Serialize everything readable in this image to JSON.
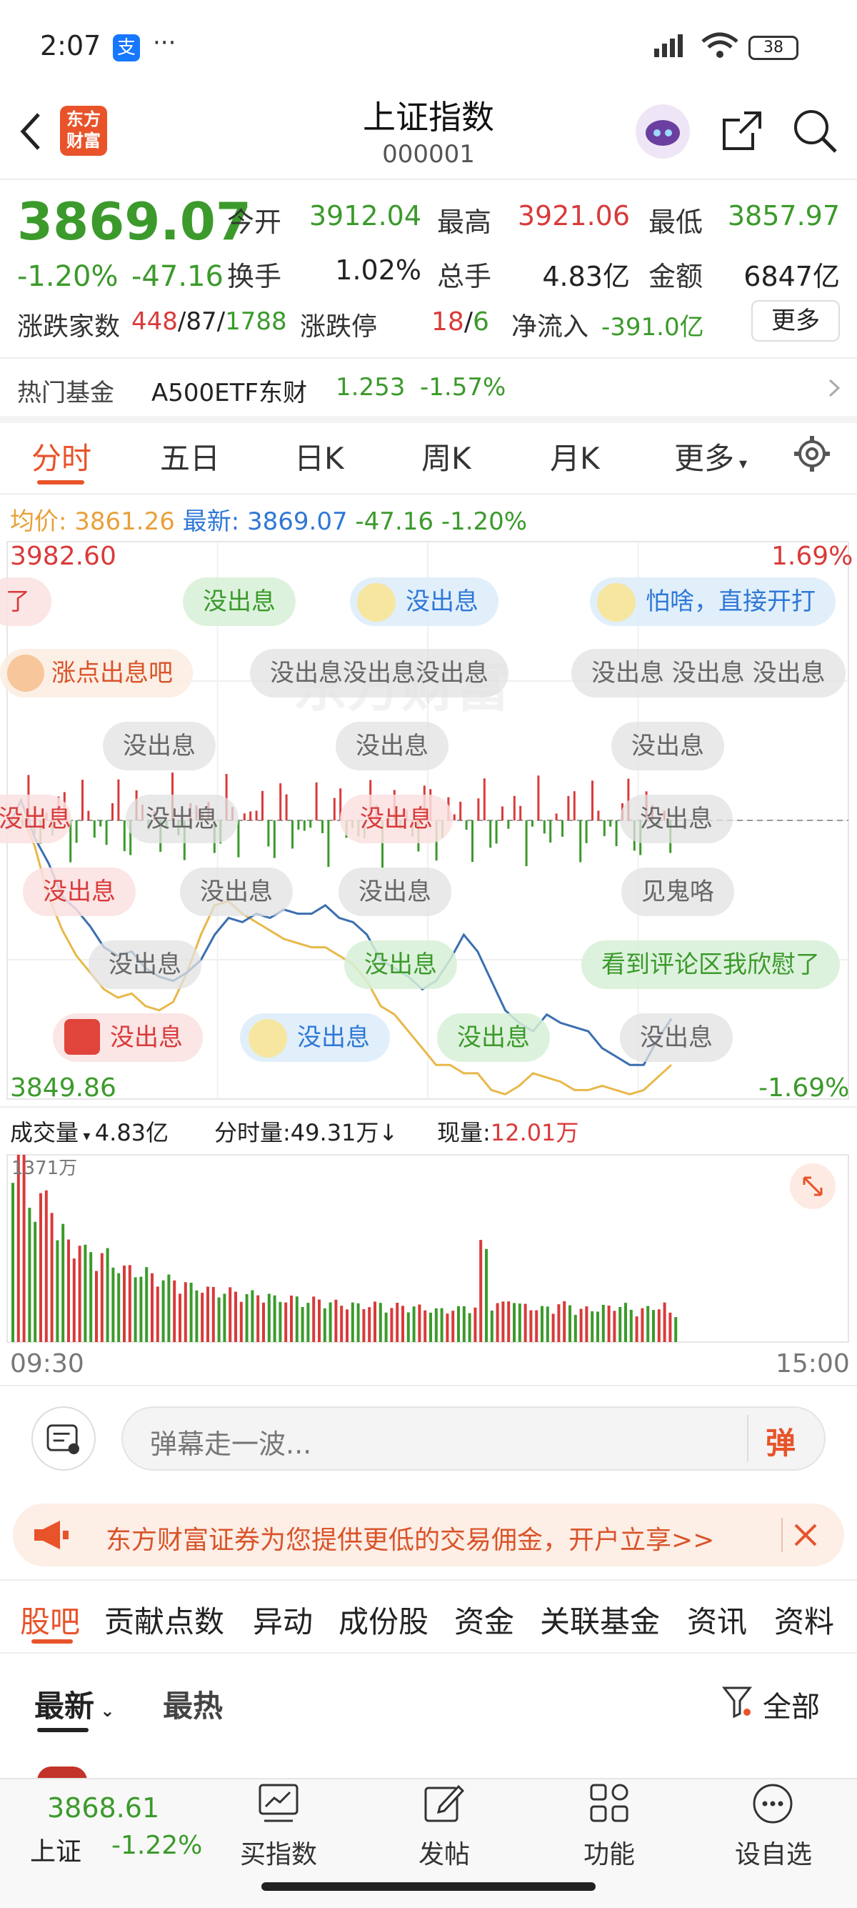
{
  "status": {
    "time": "2:07",
    "alipay": "支",
    "dots": "···",
    "battery": "38"
  },
  "header": {
    "title": "上证指数",
    "code": "000001",
    "logo_line1": "东方",
    "logo_line2": "财富"
  },
  "quote": {
    "price": "3869.07",
    "pct": "-1.20%",
    "chg": "-47.16",
    "open_lbl": "今开",
    "open": "3912.04",
    "high_lbl": "最高",
    "high": "3921.06",
    "low_lbl": "最低",
    "low": "3857.97",
    "turnover_lbl": "换手",
    "turnover": "1.02%",
    "vol_lbl": "总手",
    "vol": "4.83亿",
    "amt_lbl": "金额",
    "amt": "6847亿",
    "adv_lbl": "涨跌家数",
    "adv": "448",
    "flat": "87",
    "dec": "1788",
    "limit_lbl": "涨跌停",
    "limit_up": "18",
    "limit_down": "6",
    "inflow_lbl": "净流入",
    "inflow": "-391.0亿",
    "more": "更多"
  },
  "fund": {
    "label": "热门基金",
    "name": "A500ETF东财",
    "price": "1.253",
    "pct": "-1.57%"
  },
  "tabs": [
    "分时",
    "五日",
    "日K",
    "周K",
    "月K",
    "更多"
  ],
  "avgline": {
    "avg_lbl": "均价:",
    "avg": "3861.26",
    "new_lbl": "最新:",
    "new": "3869.07",
    "chg": "-47.16",
    "pct": "-1.20%"
  },
  "chart_labels": {
    "top_price": "3982.60",
    "top_pct": "1.69%",
    "bottom_price": "3849.86",
    "bottom_pct": "-1.69%",
    "watermark": "东方财富"
  },
  "danmaku": [
    "了",
    "没出息",
    "没出息",
    "怕啥，直接开打",
    "涨点出息吧",
    "没出息没出息没出息",
    "没出息 没出息 没出息",
    "没出息",
    "没出息",
    "没出息",
    "没出息",
    "没出息",
    "没出息",
    "没出息",
    "没出息",
    "没出息",
    "没出息",
    "见鬼咯",
    "没出息",
    "没出息",
    "看到评论区我欣慰了",
    "没出息",
    "没出息",
    "没出息",
    "没出息"
  ],
  "volinfo": {
    "vol_lbl": "成交量",
    "vol": "4.83亿",
    "min_lbl": "分时量:",
    "min": "49.31万↓",
    "now_lbl": "现量:",
    "now": "12.01万",
    "max": "1371万",
    "t_start": "09:30",
    "t_end": "15:00"
  },
  "comment": {
    "placeholder": "弹幕走一波...",
    "send": "弹"
  },
  "banner": {
    "text": "东方财富证券为您提供更低的交易佣金，开户立享>>"
  },
  "subtabs": [
    "股吧",
    "贡献点数",
    "异动",
    "成份股",
    "资金",
    "关联基金",
    "资讯",
    "资料"
  ],
  "sort": {
    "latest": "最新",
    "hot": "最热",
    "all": "全部"
  },
  "bottom": {
    "price": "3868.61",
    "name": "上证",
    "pct": "-1.22%",
    "buy": "买指数",
    "post": "发帖",
    "func": "功能",
    "fav": "设自选"
  },
  "colors": {
    "accent": "#e8532a",
    "up": "#d93a3a",
    "down": "#3b9a2b"
  },
  "chart_data": {
    "type": "line",
    "ylim": [
      3849.86,
      3982.6
    ],
    "ref": 3916.23,
    "price": [
      3914,
      3921,
      3912,
      3906,
      3898,
      3895,
      3891,
      3886,
      3884,
      3885,
      3881,
      3879,
      3878,
      3880,
      3883,
      3889,
      3893,
      3892,
      3894,
      3893,
      3895,
      3894,
      3894,
      3896,
      3893,
      3892,
      3889,
      3883,
      3881,
      3879,
      3876,
      3878,
      3883,
      3889,
      3885,
      3878,
      3871,
      3868,
      3866,
      3870,
      3868,
      3867,
      3866,
      3862,
      3860,
      3858,
      3858,
      3864,
      3869
    ],
    "avg": [
      3914,
      3918,
      3910,
      3898,
      3890,
      3884,
      3880,
      3876,
      3874,
      3875,
      3872,
      3871,
      3873,
      3880,
      3889,
      3896,
      3897,
      3894,
      3892,
      3890,
      3888,
      3887,
      3886,
      3886,
      3884,
      3882,
      3878,
      3872,
      3870,
      3866,
      3862,
      3858,
      3858,
      3856,
      3856,
      3852,
      3851,
      3853,
      3856,
      3855,
      3854,
      3852,
      3852,
      3853,
      3852,
      3851,
      3852,
      3855,
      3858
    ],
    "volume_wan": [
      1371,
      960,
      980,
      760,
      680,
      620,
      600,
      540,
      500,
      480,
      460,
      430,
      400,
      380,
      360,
      350,
      340,
      330,
      320,
      300,
      300,
      280,
      290,
      270,
      260,
      250,
      260,
      240,
      250,
      240,
      230,
      220,
      230,
      240,
      650,
      260,
      300,
      250,
      230,
      240,
      260,
      220,
      230,
      240,
      250,
      220,
      230,
      260,
      190
    ]
  }
}
